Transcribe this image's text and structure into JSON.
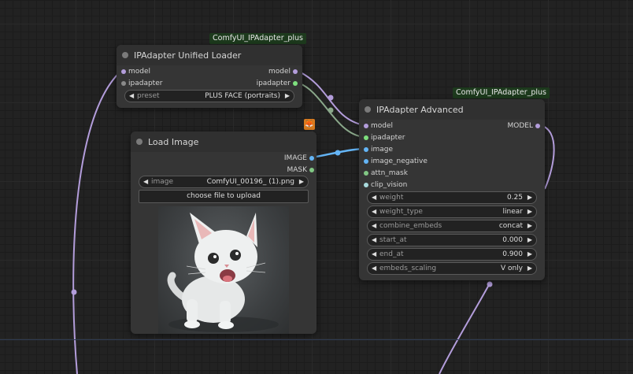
{
  "colors": {
    "model": "#b39ddb",
    "ipadapter": "#7ee07e",
    "image": "#64b5f6",
    "mask": "#81c784",
    "attn_mask": "#81c784",
    "clip_vision": "#a8dadc",
    "badge_bg": "#1d3a1d",
    "node_bg": "#353535"
  },
  "loader_node": {
    "badge": "ComfyUI_IPAdapter_plus",
    "title": "IPAdapter Unified Loader",
    "inputs": [
      "model",
      "ipadapter"
    ],
    "outputs": [
      "model",
      "ipadapter"
    ],
    "preset": {
      "label": "preset",
      "value": "PLUS FACE (portraits)"
    }
  },
  "load_image_node": {
    "title": "Load Image",
    "outputs": [
      "IMAGE",
      "MASK"
    ],
    "image": {
      "label": "image",
      "value": "ComfyUI_00196_ (1).png"
    },
    "upload_label": "choose file to upload",
    "preview_subject": "white kitten photo",
    "badge_icon": "fox-icon"
  },
  "advanced_node": {
    "badge": "ComfyUI_IPAdapter_plus",
    "title": "IPAdapter Advanced",
    "inputs": [
      "model",
      "ipadapter",
      "image",
      "image_negative",
      "attn_mask",
      "clip_vision"
    ],
    "output": "MODEL",
    "widgets": [
      {
        "label": "weight",
        "value": "0.25"
      },
      {
        "label": "weight_type",
        "value": "linear"
      },
      {
        "label": "combine_embeds",
        "value": "concat"
      },
      {
        "label": "start_at",
        "value": "0.000"
      },
      {
        "label": "end_at",
        "value": "0.900"
      },
      {
        "label": "embeds_scaling",
        "value": "V only"
      }
    ]
  }
}
